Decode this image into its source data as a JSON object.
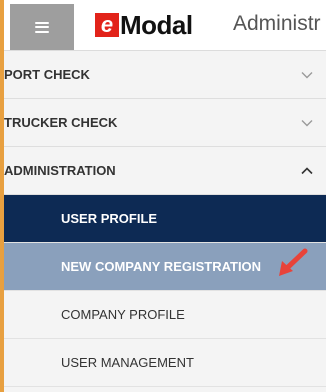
{
  "header": {
    "menu_icon": "hamburger-icon",
    "logo_letter": "e",
    "logo_text": "Modal",
    "app_title": "Administr"
  },
  "colors": {
    "brand_red": "#e2231a",
    "active_navy": "#0d2a54",
    "highlight_blue": "#8aa0bc",
    "annotation_arrow": "#e8433a"
  },
  "menu": {
    "sections": [
      {
        "label": "PORT CHECK",
        "expanded": false,
        "icon": "chevron-down-icon"
      },
      {
        "label": "TRUCKER CHECK",
        "expanded": false,
        "icon": "chevron-down-icon"
      },
      {
        "label": "ADMINISTRATION",
        "expanded": true,
        "icon": "chevron-up-icon"
      }
    ],
    "admin_items": [
      {
        "label": "USER PROFILE",
        "state": "active"
      },
      {
        "label": "NEW COMPANY REGISTRATION",
        "state": "highlighted"
      },
      {
        "label": "COMPANY PROFILE",
        "state": "normal"
      },
      {
        "label": "USER MANAGEMENT",
        "state": "normal"
      }
    ]
  }
}
